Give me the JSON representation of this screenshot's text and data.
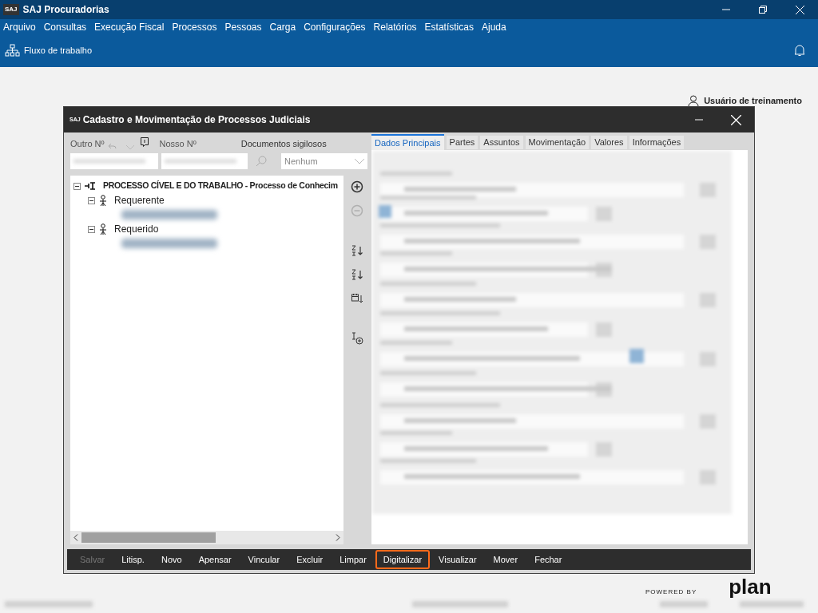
{
  "app": {
    "title": "SAJ Procuradorias",
    "logo": "SAJ"
  },
  "menu": [
    "Arquivo",
    "Consultas",
    "Execução Fiscal",
    "Processos",
    "Pessoas",
    "Carga",
    "Configurações",
    "Relatórios",
    "Estatísticas",
    "Ajuda"
  ],
  "toolbar": {
    "label": "Fluxo de trabalho"
  },
  "user": {
    "name": "Usuário de treinamento"
  },
  "branding": {
    "powered_by": "POWERED BY",
    "logo": "plan"
  },
  "dialog": {
    "logo": "SAJ",
    "title": "Cadastro e Movimentação de Processos Judiciais",
    "outro_label": "Outro Nº",
    "nosso_label": "Nosso Nº",
    "docs_label": "Documentos sigilosos",
    "docs_value": "Nenhum",
    "tree": [
      {
        "label": "PROCESSO CÍVEL E DO TRABALHO - Processo de Conhecim",
        "kind": "process",
        "expanded": true,
        "children": [
          {
            "label": "Requerente",
            "kind": "party",
            "expanded": true,
            "children": [
              {
                "kind": "redacted"
              }
            ]
          },
          {
            "label": "Requerido",
            "kind": "party",
            "expanded": true,
            "children": [
              {
                "kind": "redacted"
              }
            ]
          }
        ]
      }
    ],
    "tree_tools": [
      {
        "kind": "add",
        "disabled": false
      },
      {
        "kind": "remove",
        "disabled": true
      },
      {
        "kind": "sort_az",
        "disabled": false
      },
      {
        "kind": "sort_za",
        "disabled": false
      },
      {
        "kind": "sort_date",
        "disabled": false
      },
      {
        "kind": "add_item",
        "disabled": false
      }
    ],
    "tabs": [
      {
        "label": "Dados Principais",
        "selected": true
      },
      {
        "label": "Partes",
        "selected": false
      },
      {
        "label": "Assuntos",
        "selected": false
      },
      {
        "label": "Movimentação",
        "selected": false
      },
      {
        "label": "Valores",
        "selected": false
      },
      {
        "label": "Informações",
        "selected": false
      }
    ],
    "buttons": [
      {
        "label": "Salvar",
        "disabled": true,
        "highlighted": false
      },
      {
        "label": "Litisp.",
        "disabled": false,
        "highlighted": false
      },
      {
        "label": "Novo",
        "disabled": false,
        "highlighted": false
      },
      {
        "label": "Apensar",
        "disabled": false,
        "highlighted": false
      },
      {
        "label": "Vincular",
        "disabled": false,
        "highlighted": false
      },
      {
        "label": "Excluir",
        "disabled": false,
        "highlighted": false
      },
      {
        "label": "Limpar",
        "disabled": false,
        "highlighted": false
      },
      {
        "label": "Digitalizar",
        "disabled": false,
        "highlighted": true
      },
      {
        "label": "Visualizar",
        "disabled": false,
        "highlighted": false
      },
      {
        "label": "Mover",
        "disabled": false,
        "highlighted": false
      },
      {
        "label": "Fechar",
        "disabled": false,
        "highlighted": false
      }
    ]
  }
}
